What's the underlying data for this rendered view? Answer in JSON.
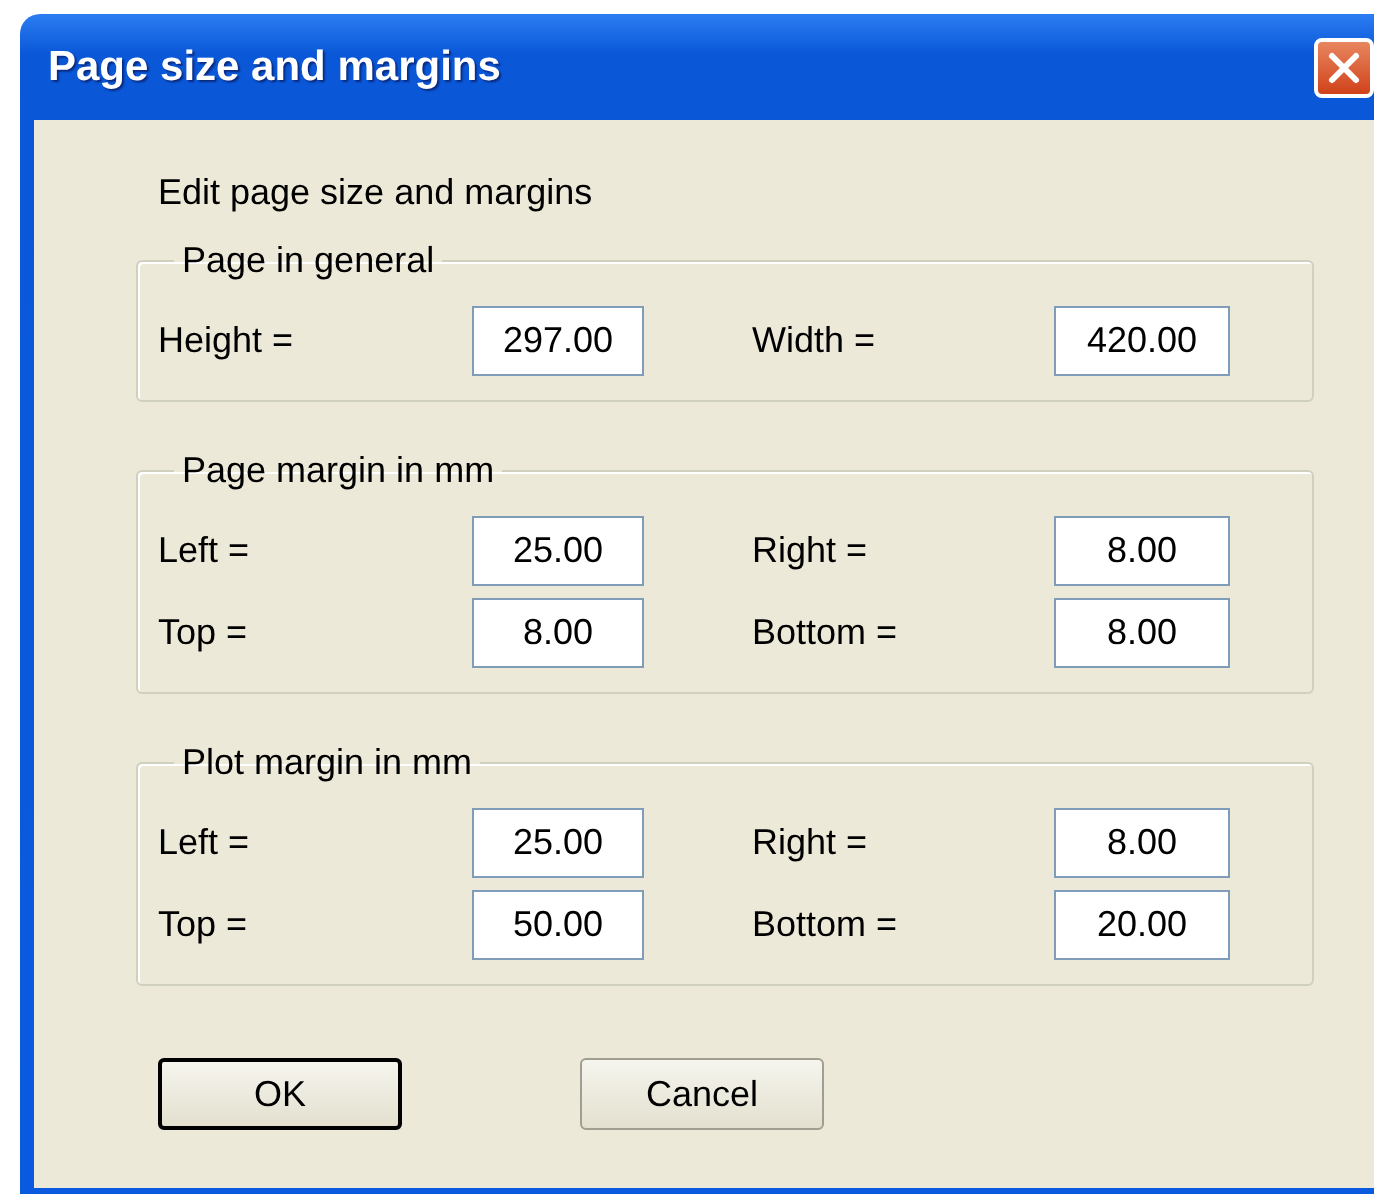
{
  "window": {
    "title": "Page size and margins"
  },
  "heading": "Edit page size and margins",
  "groups": [
    {
      "title": "Page in general",
      "rows": [
        [
          {
            "label": "Height =",
            "value": "297.00"
          },
          {
            "label": "Width =",
            "value": "420.00"
          }
        ]
      ]
    },
    {
      "title": "Page margin in mm",
      "rows": [
        [
          {
            "label": "Left =",
            "value": "25.00"
          },
          {
            "label": "Right =",
            "value": "8.00"
          }
        ],
        [
          {
            "label": "Top =",
            "value": "8.00"
          },
          {
            "label": "Bottom =",
            "value": "8.00"
          }
        ]
      ]
    },
    {
      "title": "Plot margin in mm",
      "rows": [
        [
          {
            "label": "Left =",
            "value": "25.00"
          },
          {
            "label": "Right =",
            "value": "8.00"
          }
        ],
        [
          {
            "label": "Top =",
            "value": "50.00"
          },
          {
            "label": "Bottom =",
            "value": "20.00"
          }
        ]
      ]
    }
  ],
  "buttons": [
    {
      "label": "OK",
      "default": true
    },
    {
      "label": "Cancel",
      "default": false
    }
  ]
}
